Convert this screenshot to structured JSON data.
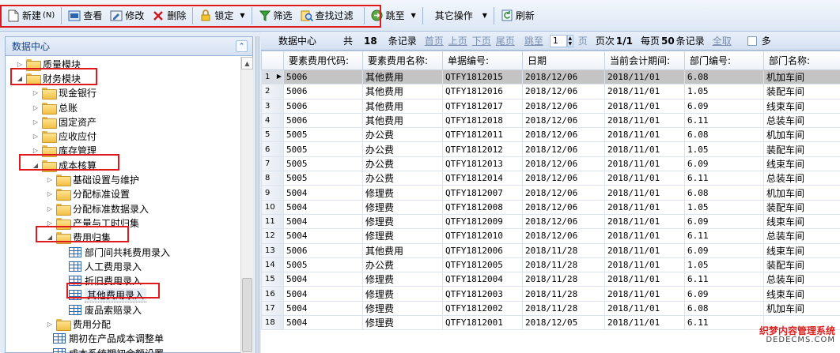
{
  "toolbar": {
    "new_label": "新建",
    "new_shortcut": "(N)",
    "view_label": "查看",
    "edit_label": "修改",
    "delete_label": "删除",
    "lock_label": "锁定",
    "filter_label": "筛选",
    "find_filter_label": "查找过滤",
    "goto_label": "跳至",
    "other_ops_label": "其它操作",
    "refresh_label": "刷新"
  },
  "left_panel": {
    "title": "数据中心",
    "tree": [
      {
        "label": "质量模块",
        "level": 0,
        "type": "folder",
        "expanded": false
      },
      {
        "label": "财务模块",
        "level": 0,
        "type": "folder",
        "expanded": true
      },
      {
        "label": "现金银行",
        "level": 1,
        "type": "folder",
        "expanded": false
      },
      {
        "label": "总账",
        "level": 1,
        "type": "folder",
        "expanded": false
      },
      {
        "label": "固定资产",
        "level": 1,
        "type": "folder",
        "expanded": false
      },
      {
        "label": "应收应付",
        "level": 1,
        "type": "folder",
        "expanded": false
      },
      {
        "label": "库存管理",
        "level": 1,
        "type": "folder",
        "expanded": false
      },
      {
        "label": "成本核算",
        "level": 1,
        "type": "folder",
        "expanded": true
      },
      {
        "label": "基础设置与维护",
        "level": 2,
        "type": "folder",
        "expanded": false
      },
      {
        "label": "分配标准设置",
        "level": 2,
        "type": "folder",
        "expanded": false
      },
      {
        "label": "分配标准数据录入",
        "level": 2,
        "type": "folder",
        "expanded": false
      },
      {
        "label": "产量与工时归集",
        "level": 2,
        "type": "folder",
        "expanded": false
      },
      {
        "label": "费用归集",
        "level": 2,
        "type": "folder",
        "expanded": true
      },
      {
        "label": "部门间共耗费用录入",
        "level": 3,
        "type": "grid"
      },
      {
        "label": "人工费用录入",
        "level": 3,
        "type": "grid"
      },
      {
        "label": "折旧费用录入",
        "level": 3,
        "type": "grid"
      },
      {
        "label": "其他费用录入",
        "level": 3,
        "type": "grid",
        "selected": true
      },
      {
        "label": "废品索赔录入",
        "level": 3,
        "type": "grid"
      },
      {
        "label": "费用分配",
        "level": 2,
        "type": "folder",
        "expanded": false
      },
      {
        "label": "期初在产品成本调整单",
        "level": 2,
        "type": "grid"
      },
      {
        "label": "成本系统期初余额设置",
        "level": 2,
        "type": "grid"
      }
    ]
  },
  "pager": {
    "title": "数据中心",
    "total_prefix": "共",
    "total": "18",
    "total_suffix": "条记录",
    "first": "首页",
    "prev": "上页",
    "next": "下页",
    "last": "尾页",
    "goto": "跳至",
    "page_value": "1",
    "page_unit": "页",
    "page_info_prefix": "页次",
    "page_info": "1/1",
    "per_page_prefix": "每页",
    "per_page": "50",
    "per_page_suffix": "条记录",
    "all": "全取",
    "multi": "多"
  },
  "grid": {
    "columns": [
      "要素费用代码:",
      "要素费用名称:",
      "单据编号:",
      "日期",
      "当前会计期间:",
      "部门编号:",
      "部门名称:"
    ],
    "rows": [
      [
        "1",
        "5006",
        "其他费用",
        "QTFY1812015",
        "2018/12/06",
        "2018/11/01",
        "6.08",
        "机加车间"
      ],
      [
        "2",
        "5006",
        "其他费用",
        "QTFY1812016",
        "2018/12/06",
        "2018/11/01",
        "1.05",
        "装配车间"
      ],
      [
        "3",
        "5006",
        "其他费用",
        "QTFY1812017",
        "2018/12/06",
        "2018/11/01",
        "6.09",
        "线束车间"
      ],
      [
        "4",
        "5006",
        "其他费用",
        "QTFY1812018",
        "2018/12/06",
        "2018/11/01",
        "6.11",
        "总装车间"
      ],
      [
        "5",
        "5005",
        "办公费",
        "QTFY1812011",
        "2018/12/06",
        "2018/11/01",
        "6.08",
        "机加车间"
      ],
      [
        "6",
        "5005",
        "办公费",
        "QTFY1812012",
        "2018/12/06",
        "2018/11/01",
        "1.05",
        "装配车间"
      ],
      [
        "7",
        "5005",
        "办公费",
        "QTFY1812013",
        "2018/12/06",
        "2018/11/01",
        "6.09",
        "线束车间"
      ],
      [
        "8",
        "5005",
        "办公费",
        "QTFY1812014",
        "2018/12/06",
        "2018/11/01",
        "6.11",
        "总装车间"
      ],
      [
        "9",
        "5004",
        "修理费",
        "QTFY1812007",
        "2018/12/06",
        "2018/11/01",
        "6.08",
        "机加车间"
      ],
      [
        "10",
        "5004",
        "修理费",
        "QTFY1812008",
        "2018/12/06",
        "2018/11/01",
        "1.05",
        "装配车间"
      ],
      [
        "11",
        "5004",
        "修理费",
        "QTFY1812009",
        "2018/12/06",
        "2018/11/01",
        "6.09",
        "线束车间"
      ],
      [
        "12",
        "5004",
        "修理费",
        "QTFY1812010",
        "2018/12/06",
        "2018/11/01",
        "6.11",
        "总装车间"
      ],
      [
        "13",
        "5006",
        "其他费用",
        "QTFY1812006",
        "2018/11/28",
        "2018/11/01",
        "6.09",
        "线束车间"
      ],
      [
        "14",
        "5005",
        "办公费",
        "QTFY1812005",
        "2018/11/28",
        "2018/11/01",
        "1.05",
        "装配车间"
      ],
      [
        "15",
        "5004",
        "修理费",
        "QTFY1812004",
        "2018/11/28",
        "2018/11/01",
        "6.11",
        "总装车间"
      ],
      [
        "16",
        "5004",
        "修理费",
        "QTFY1812003",
        "2018/11/28",
        "2018/11/01",
        "6.09",
        "线束车间"
      ],
      [
        "17",
        "5004",
        "修理费",
        "QTFY1812002",
        "2018/11/28",
        "2018/11/01",
        "6.08",
        "机加车间"
      ],
      [
        "18",
        "5004",
        "修理费",
        "QTFY1812001",
        "2018/12/05",
        "2018/11/01",
        "6.11",
        ""
      ]
    ],
    "selected_row": 0
  },
  "watermark": {
    "line1": "织梦内容管理系统",
    "line2": "DEDECMS.COM"
  },
  "colors": {
    "highlight_red": "#e0191d",
    "header_blue": "#15428b",
    "selected_row": "#c4c4c4"
  }
}
